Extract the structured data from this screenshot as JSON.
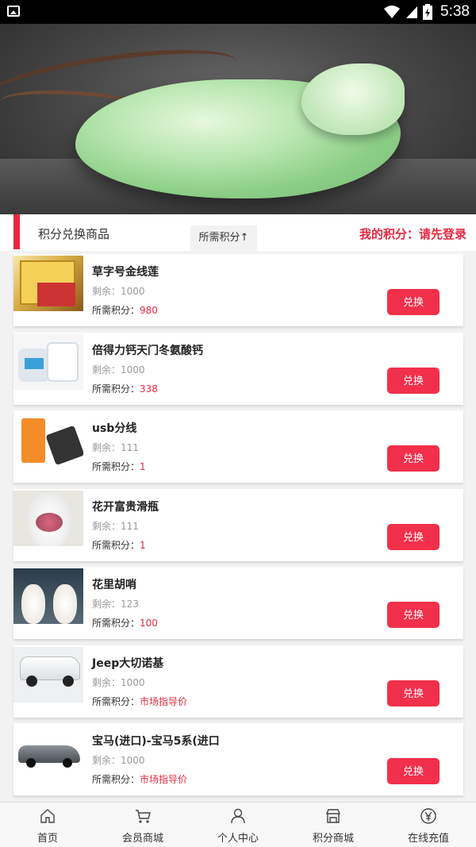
{
  "status_bar": {
    "time": "5:38"
  },
  "section": {
    "title": "积分兑换商品",
    "sort_label": "所需积分↑",
    "my_points": "我的积分：请先登录"
  },
  "items": [
    {
      "name": "草字号金线莲",
      "remaining": "剩余：1000",
      "points_label": "所需积分：",
      "points": "980",
      "button": "兑换",
      "thumb": "gold"
    },
    {
      "name": "倍得力钙天门冬氨酸钙",
      "remaining": "剩余：1000",
      "points_label": "所需积分：",
      "points": "338",
      "button": "兑换",
      "thumb": "milk"
    },
    {
      "name": "usb分线",
      "remaining": "剩余：111",
      "points_label": "所需积分：",
      "points": "1",
      "button": "兑换",
      "thumb": "usb"
    },
    {
      "name": "花开富贵滑瓶",
      "remaining": "剩余：111",
      "points_label": "所需积分：",
      "points": "1",
      "button": "兑换",
      "thumb": "vase"
    },
    {
      "name": "花里胡哨",
      "remaining": "剩余：123",
      "points_label": "所需积分：",
      "points": "100",
      "button": "兑换",
      "thumb": "vase2"
    },
    {
      "name": "Jeep大切诺基",
      "remaining": "剩余：1000",
      "points_label": "所需积分：",
      "points": "市场指导价",
      "button": "兑换",
      "thumb": "jeep"
    },
    {
      "name": "宝马(进口)-宝马5系(进口",
      "remaining": "剩余：1000",
      "points_label": "所需积分：",
      "points": "市场指导价",
      "button": "兑换",
      "thumb": "bmw"
    }
  ],
  "tabbar": [
    {
      "label": "首页",
      "icon": "home-icon"
    },
    {
      "label": "会员商城",
      "icon": "cart-icon"
    },
    {
      "label": "个人中心",
      "icon": "user-icon"
    },
    {
      "label": "积分商城",
      "icon": "store-icon"
    },
    {
      "label": "在线充值",
      "icon": "yuan-icon"
    }
  ],
  "colors": {
    "accent": "#e8283f",
    "button": "#f2304b"
  }
}
